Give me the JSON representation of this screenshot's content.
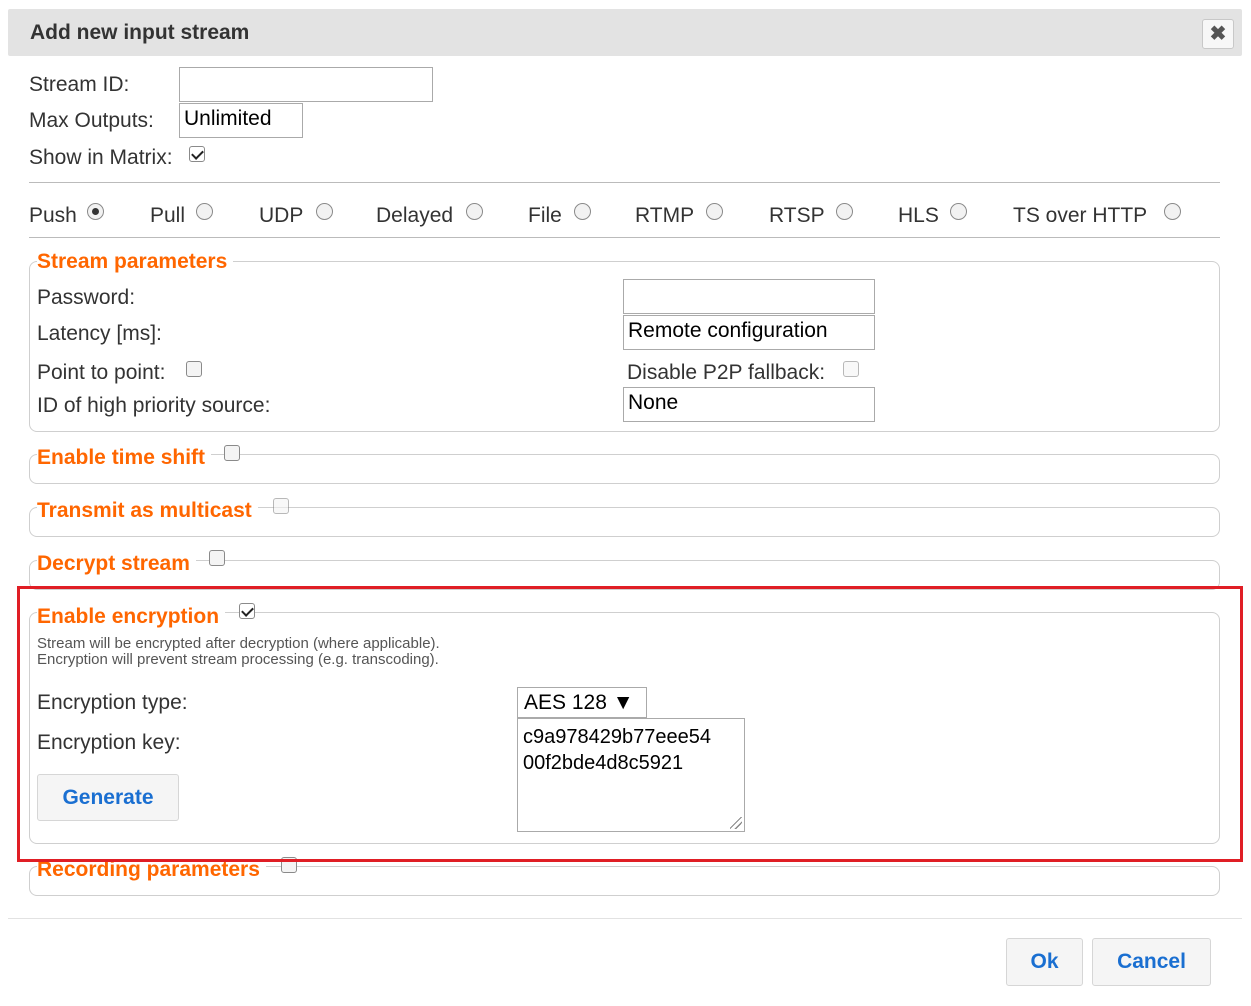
{
  "dialog": {
    "title": "Add new input stream",
    "close_symbol": "✖"
  },
  "general": {
    "stream_id_label": "Stream ID:",
    "stream_id_value": "",
    "max_outputs_label": "Max Outputs:",
    "max_outputs_value": "Unlimited",
    "show_in_matrix_label": "Show in Matrix:",
    "show_in_matrix_checked": true
  },
  "stream_types": [
    {
      "label": "Push",
      "checked": true
    },
    {
      "label": "Pull",
      "checked": false
    },
    {
      "label": "UDP",
      "checked": false
    },
    {
      "label": "Delayed",
      "checked": false
    },
    {
      "label": "File",
      "checked": false
    },
    {
      "label": "RTMP",
      "checked": false
    },
    {
      "label": "RTSP",
      "checked": false
    },
    {
      "label": "HLS",
      "checked": false
    },
    {
      "label": "TS over HTTP",
      "checked": false
    }
  ],
  "stream_params": {
    "legend": "Stream parameters",
    "password_label": "Password:",
    "password_value": "",
    "latency_label": "Latency [ms]:",
    "latency_value": "Remote configuration",
    "p2p_label": "Point to point:",
    "disable_p2p_label": "Disable P2P fallback:",
    "priority_label": "ID of high priority source:",
    "priority_value": "None"
  },
  "sections": {
    "time_shift": "Enable time shift",
    "multicast": "Transmit as multicast",
    "decrypt": "Decrypt stream",
    "encryption": "Enable encryption",
    "recording": "Recording parameters"
  },
  "encryption": {
    "note_line1": "Stream will be encrypted after decryption (where applicable).",
    "note_line2": "Encryption will prevent stream processing (e.g. transcoding).",
    "type_label": "Encryption type:",
    "type_value": "AES 128 ▼",
    "key_label": "Encryption key:",
    "key_value": "c9a978429b77eee54\n00f2bde4d8c5921",
    "generate_label": "Generate"
  },
  "footer": {
    "ok_label": "Ok",
    "cancel_label": "Cancel"
  },
  "colors": {
    "legend": "#ff6600",
    "button_text": "#1a6fd1",
    "highlight": "#e01e25"
  }
}
